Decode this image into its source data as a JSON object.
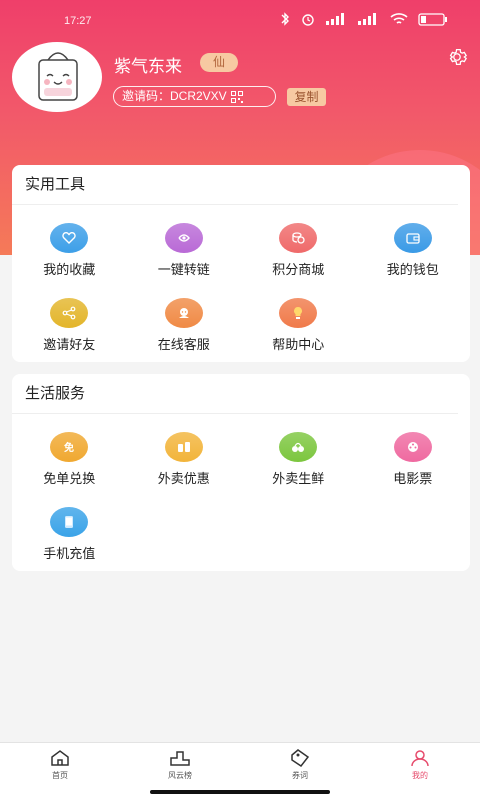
{
  "status_bar": {
    "time": "17:27"
  },
  "profile": {
    "username": "紫气东来",
    "level_badge": "仙",
    "invite_label": "邀请码：DCR2VXV",
    "copy_label": "复制"
  },
  "tools": {
    "title": "实用工具",
    "items": [
      {
        "label": "我的收藏",
        "icon": "heart-icon",
        "color": "#3d9fe8"
      },
      {
        "label": "一键转链",
        "icon": "link-icon",
        "color": "#b96ad6"
      },
      {
        "label": "积分商城",
        "icon": "coins-icon",
        "color": "#ef6a6a"
      },
      {
        "label": "我的钱包",
        "icon": "wallet-icon",
        "color": "#3a9ae6"
      },
      {
        "label": "邀请好友",
        "icon": "share-icon",
        "color": "#e3b52a"
      },
      {
        "label": "在线客服",
        "icon": "support-icon",
        "color": "#f08a45"
      },
      {
        "label": "帮助中心",
        "icon": "lightbulb-icon",
        "color": "#f07a4a"
      }
    ]
  },
  "life": {
    "title": "生活服务",
    "items": [
      {
        "label": "免单兑换",
        "icon": "free-icon",
        "color": "#f0a830"
      },
      {
        "label": "外卖优惠",
        "icon": "takeaway-icon",
        "color": "#f2b43a"
      },
      {
        "label": "外卖生鲜",
        "icon": "fresh-icon",
        "color": "#7cc63e"
      },
      {
        "label": "电影票",
        "icon": "film-icon",
        "color": "#ef6aa0"
      },
      {
        "label": "手机充值",
        "icon": "phone-recharge-icon",
        "color": "#3aa3e8"
      }
    ]
  },
  "tabbar": {
    "home": "首页",
    "rank": "风云榜",
    "orders": "券词",
    "mine": "我的"
  }
}
